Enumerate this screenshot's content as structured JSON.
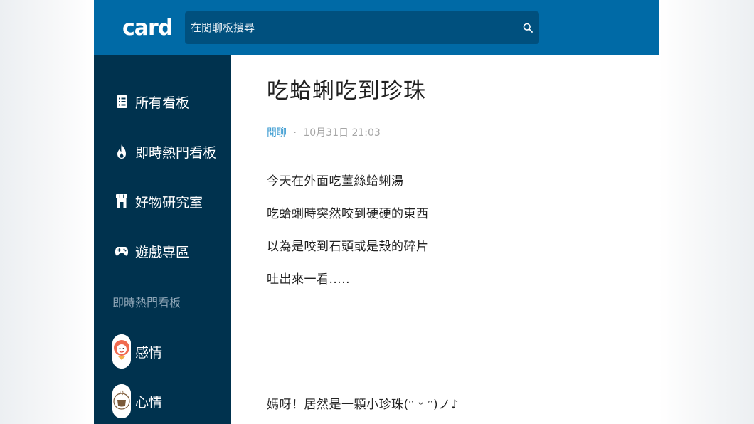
{
  "header": {
    "logo_text": "card",
    "search": {
      "placeholder": "在閒聊板搜尋",
      "value": ""
    }
  },
  "sidebar": {
    "nav": [
      {
        "label": "所有看板",
        "icon": "list-icon"
      },
      {
        "label": "即時熱門看板",
        "icon": "flame-icon"
      },
      {
        "label": "好物研究室",
        "icon": "shop-icon"
      },
      {
        "label": "遊戲專區",
        "icon": "gamepad-icon"
      }
    ],
    "section_label": "即時熱門看板",
    "boards": [
      {
        "label": "感情",
        "icon": "love-avatar"
      },
      {
        "label": "心情",
        "icon": "mood-avatar"
      }
    ]
  },
  "post": {
    "title": "吃蛤蜊吃到珍珠",
    "board": "閒聊",
    "separator": "·",
    "date": "10月31日 21:03",
    "lines": [
      "今天在外面吃薑絲蛤蜊湯",
      "吃蛤蜊時突然咬到硬硬的東西",
      "以為是咬到石頭或是殼的碎片",
      "吐出來一看.....",
      "媽呀！居然是一顆小珍珠(ᵔ ᵕ ᵔ)ノ♪"
    ]
  },
  "colors": {
    "header_bg": "#006aa6",
    "search_bg": "#00507e",
    "sidebar_bg": "#00324e",
    "board_link": "#3397cf"
  }
}
